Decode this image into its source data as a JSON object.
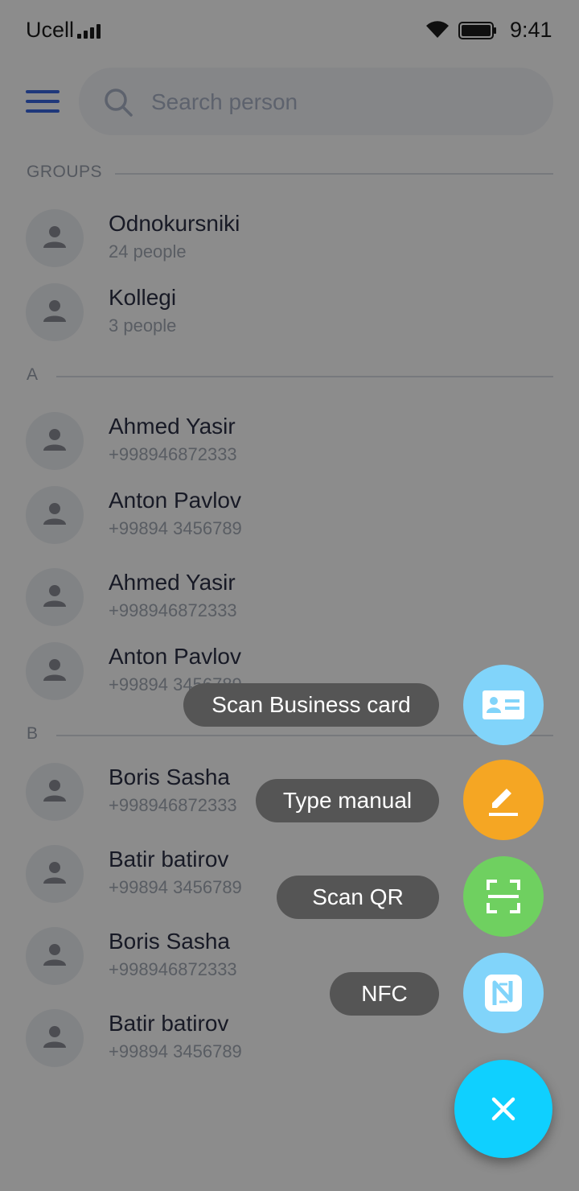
{
  "status_bar": {
    "carrier": "Ucell",
    "time": "9:41"
  },
  "search": {
    "placeholder": "Search person"
  },
  "sections": {
    "groups": "GROUPS",
    "a": "A",
    "b": "B"
  },
  "groups": [
    {
      "name": "Odnokursniki",
      "sub": "24 people"
    },
    {
      "name": "Kollegi",
      "sub": "3 people"
    }
  ],
  "contacts_a": [
    {
      "name": "Ahmed Yasir",
      "phone": "+998946872333"
    },
    {
      "name": "Anton Pavlov",
      "phone": "+99894 3456789"
    },
    {
      "name": "Ahmed Yasir",
      "phone": "+998946872333"
    },
    {
      "name": "Anton Pavlov",
      "phone": "+99894 3456789"
    }
  ],
  "contacts_b": [
    {
      "name": "Boris Sasha",
      "phone": "+998946872333"
    },
    {
      "name": "Batir batirov",
      "phone": "+99894 3456789"
    },
    {
      "name": "Boris Sasha",
      "phone": "+998946872333"
    },
    {
      "name": "Batir batirov",
      "phone": "+99894 3456789"
    }
  ],
  "speed_dial": {
    "actions": [
      {
        "label": "Scan Business card",
        "icon": "business-card-icon",
        "color": "#81d4fa"
      },
      {
        "label": "Type manual",
        "icon": "pencil-icon",
        "color": "#f5a623"
      },
      {
        "label": "Scan QR",
        "icon": "qr-scan-icon",
        "color": "#6fd060"
      },
      {
        "label": "NFC",
        "icon": "nfc-icon",
        "color": "#81d4fa"
      }
    ],
    "close_icon": "close-icon",
    "main_color": "#0fd0ff"
  },
  "colors": {
    "accent": "#3a66e0",
    "scrim": "rgba(0,0,0,0.45)"
  }
}
